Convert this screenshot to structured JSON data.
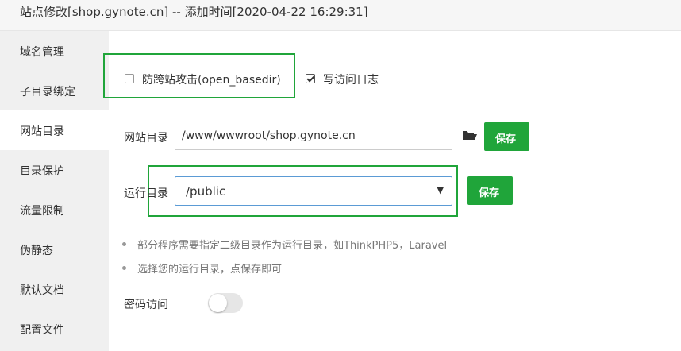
{
  "window": {
    "title": "站点修改[shop.gynote.cn] -- 添加时间[2020-04-22 16:29:31]"
  },
  "sidebar": {
    "items": [
      {
        "label": "域名管理"
      },
      {
        "label": "子目录绑定"
      },
      {
        "label": "网站目录",
        "active": true
      },
      {
        "label": "目录保护"
      },
      {
        "label": "流量限制"
      },
      {
        "label": "伪静态"
      },
      {
        "label": "默认文档"
      },
      {
        "label": "配置文件"
      }
    ]
  },
  "options": {
    "anti_cross_site": {
      "label": "防跨站攻击(open_basedir)",
      "checked": false
    },
    "access_log": {
      "label": "写访问日志",
      "checked": true
    }
  },
  "site_dir": {
    "label": "网站目录",
    "value": "/www/wwwroot/shop.gynote.cn",
    "folder_icon": "folder-open-icon",
    "save_label": "保存"
  },
  "run_dir": {
    "label": "运行目录",
    "selected": "/public",
    "save_label": "保存"
  },
  "hints": [
    "部分程序需要指定二级目录作为运行目录，如ThinkPHP5，Laravel",
    "选择您的运行目录，点保存即可"
  ],
  "password_access": {
    "label": "密码访问",
    "enabled": false
  },
  "colors": {
    "accent": "#20a53a",
    "highlight": "#20a53a",
    "sidebar_bg": "#f0f0f0"
  }
}
